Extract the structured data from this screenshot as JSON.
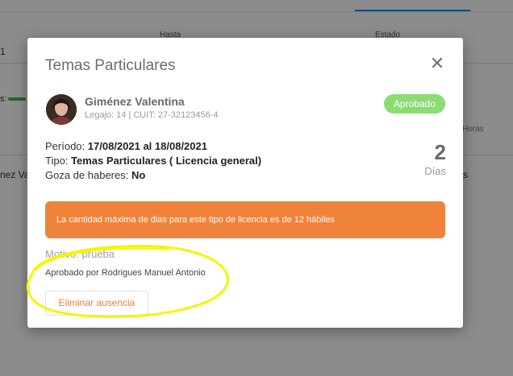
{
  "background": {
    "columns": {
      "hasta": "Hasta",
      "estado": "Estado"
    },
    "row": {
      "first_cell": "1",
      "label_fragment": "s:",
      "name_fragment": "nez Va",
      "hours": "Horas",
      "tail_fragment": "s"
    }
  },
  "modal": {
    "title": "Temas Particulares",
    "person": {
      "name": "Giménez Valentina",
      "subtitle": "Legajo: 14 | CUIT: 27-32123456-4"
    },
    "status": "Aprobado",
    "periodo_label": "Período:",
    "periodo_value": "17/08/2021 al 18/08/2021",
    "tipo_label": "Tipo:",
    "tipo_value": "Temas Particulares ( Licencia general)",
    "goza_label": "Goza de haberes:",
    "goza_value": "No",
    "days_count": "2",
    "days_label": "Días",
    "alert_text": "La cantidad máxima de dias para este tipo de licencia es de 12 hábiles",
    "motivo": "Motivo: prueba",
    "approved_by": "Aprobado por Rodrigues Manuel Antonio",
    "delete_label": "Eliminar ausencia",
    "close_symbol": "✕"
  },
  "colors": {
    "alert": "#f0833c",
    "status_badge": "#8bdc72",
    "highlight": "#f5f500",
    "tab_accent": "#1e88e5"
  }
}
